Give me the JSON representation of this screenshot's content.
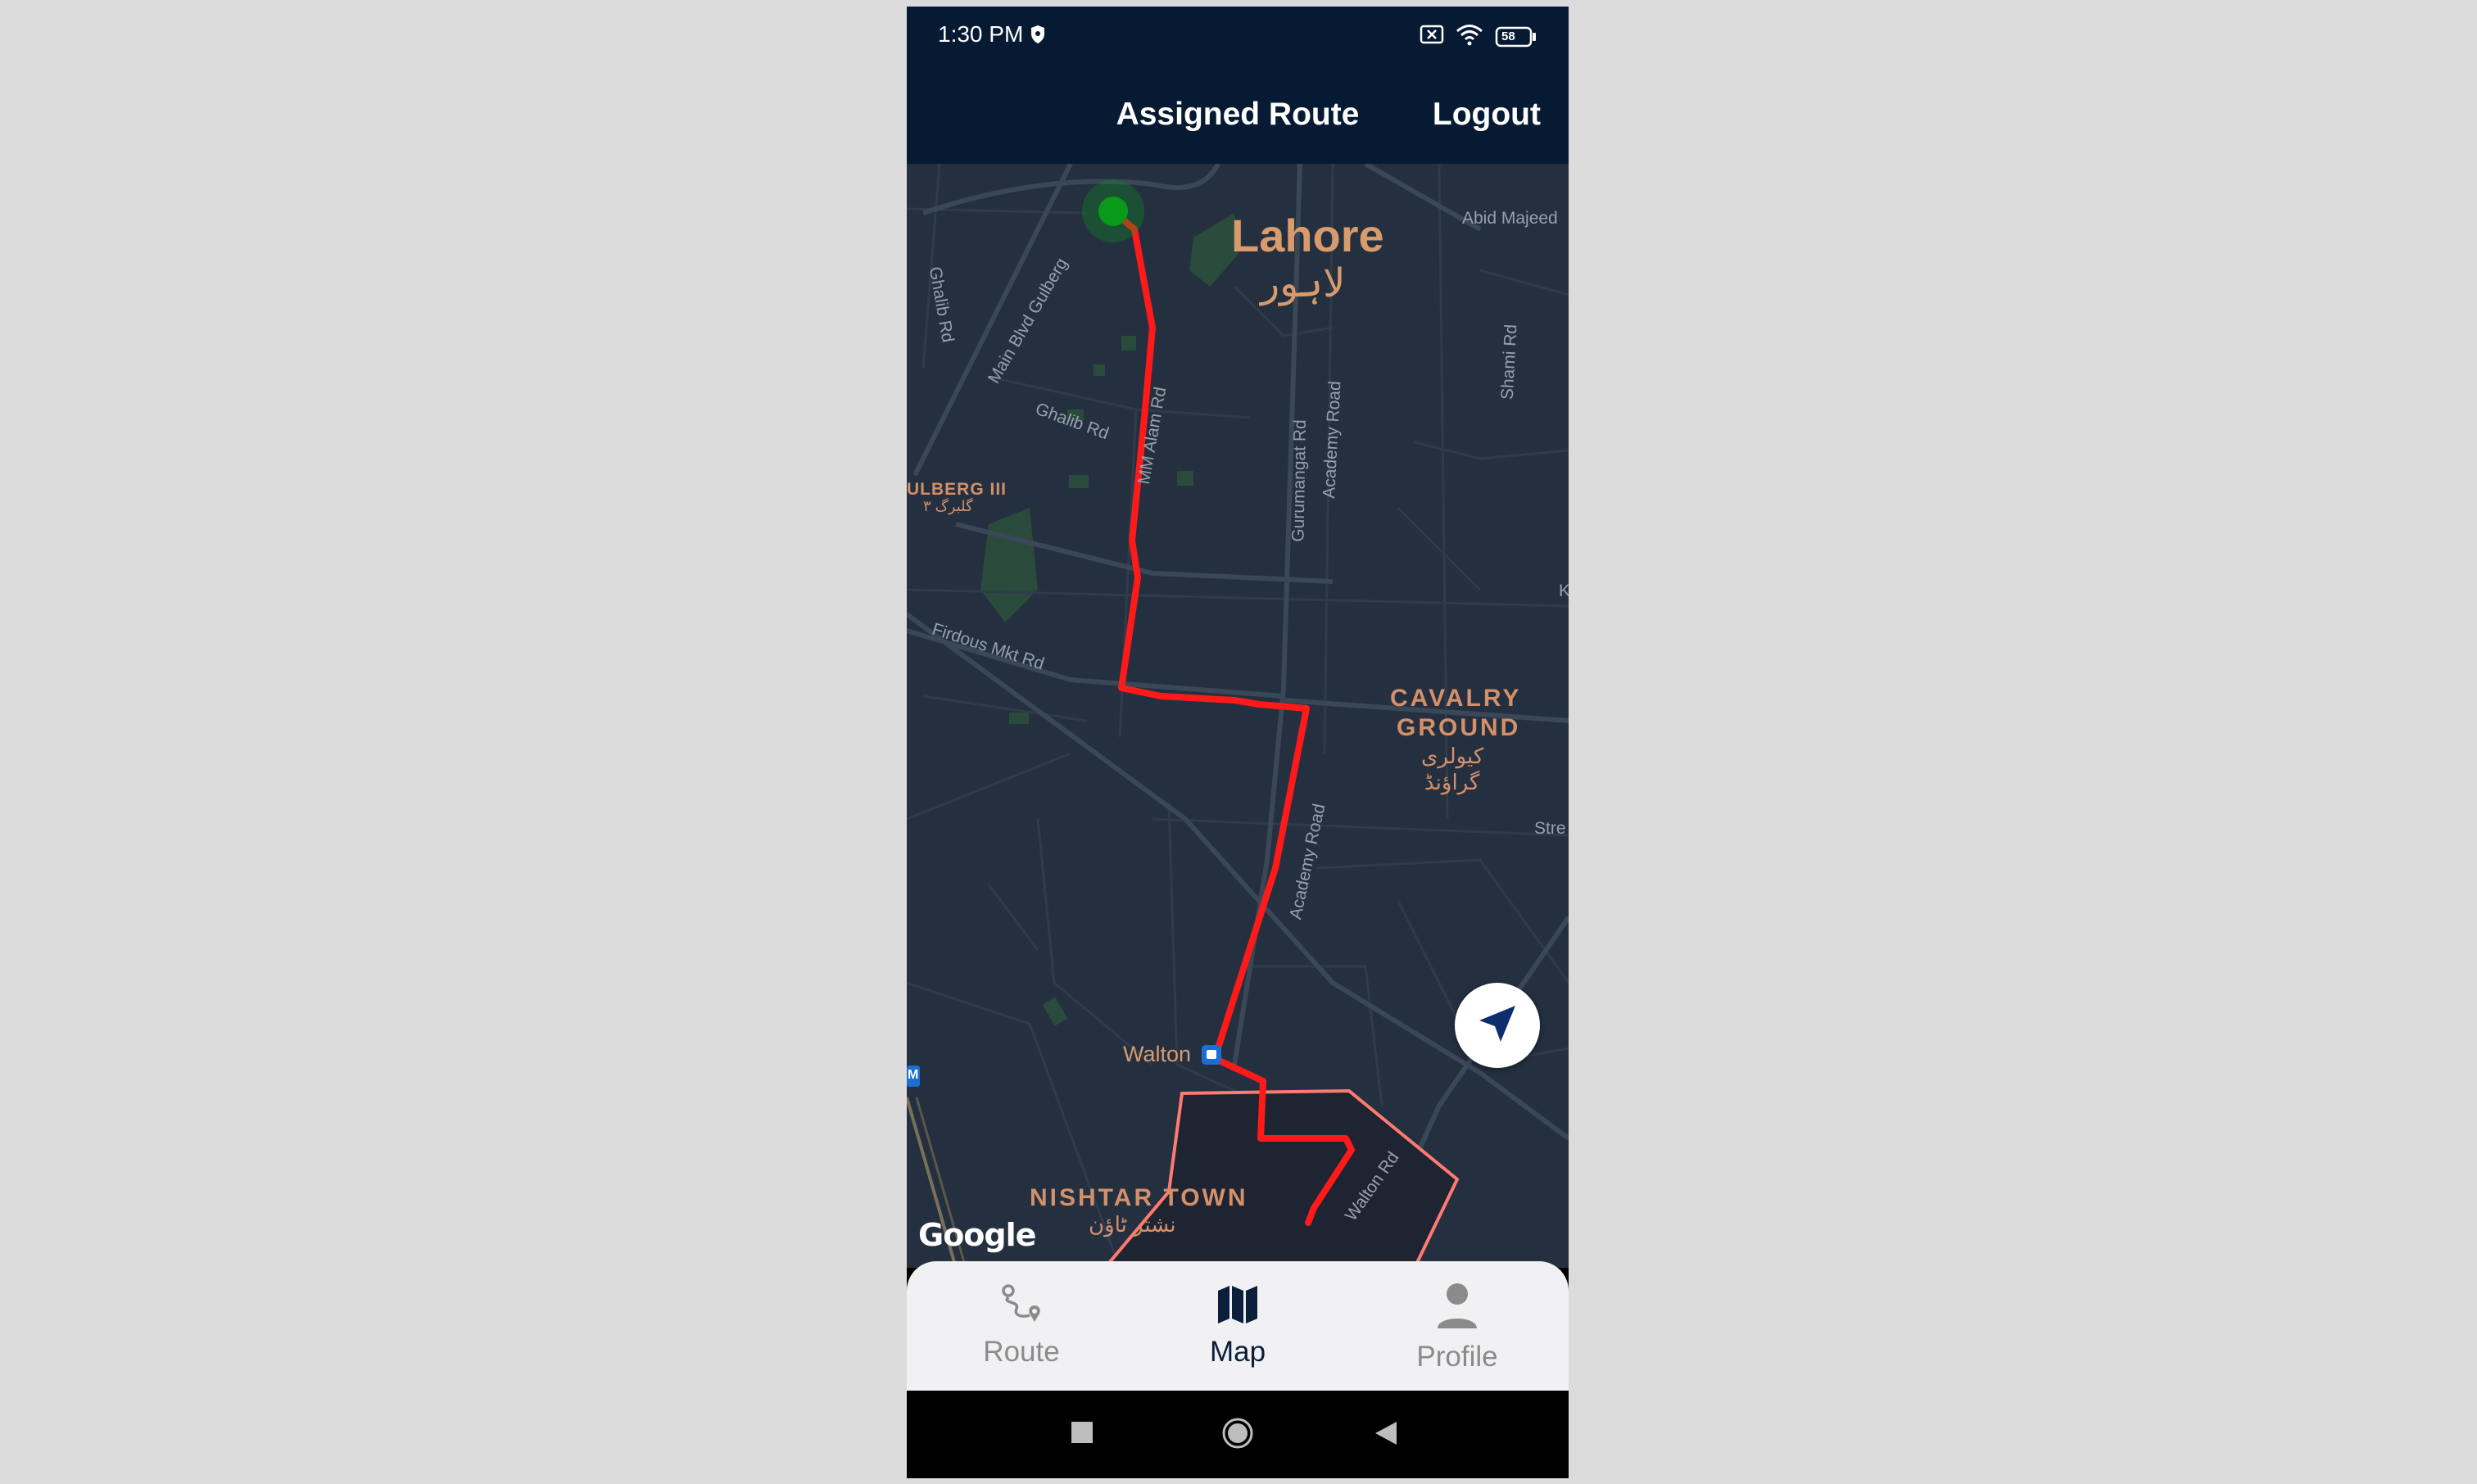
{
  "status_bar": {
    "time": "1:30 PM",
    "battery": "58",
    "icons": [
      "shield-icon",
      "data-off-icon",
      "wifi-icon",
      "battery-icon"
    ]
  },
  "header": {
    "title": "Assigned Route",
    "logout_label": "Logout"
  },
  "map": {
    "city_name": "Lahore",
    "city_name_urdu": "لاہور",
    "districts": {
      "gulberg": "ULBERG III",
      "gulberg_urdu": "گلبرگ ۳",
      "cavalry_line1": "CAVALRY",
      "cavalry_line2": "GROUND",
      "cavalry_urdu1": "کیولری",
      "cavalry_urdu2": "گراؤنڈ",
      "nishtar": "NISHTAR TOWN",
      "nishtar_urdu": "نشتر ٹاؤن"
    },
    "roads": {
      "abid_majeed": "Abid Majeed",
      "ghalib_rd_1": "Ghalib Rd",
      "main_blvd": "Main Blvd Gulberg",
      "ghalib_rd_2": "Ghalib Rd",
      "mm_alam": "MM Alam Rd",
      "gurumangat": "Gurumangat Rd",
      "academy_road_1": "Academy Road",
      "shami_rd": "Shami Rd",
      "firdous": "Firdous Mkt Rd",
      "academy_road_2": "Academy Road",
      "walton_rd": "Walton Rd",
      "stre": "Stre",
      "k": "K"
    },
    "station_name": "Walton",
    "metro_badge": "M",
    "attribution": "Google",
    "colors": {
      "route": "#ff1a1a",
      "start_marker": "#0a9a1a",
      "area_outline": "#ff7a70",
      "map_bg": "#243040"
    }
  },
  "locate_button_icon": "navigation-arrow-icon",
  "bottom_nav": {
    "items": [
      {
        "label": "Route",
        "icon": "route-icon",
        "active": false
      },
      {
        "label": "Map",
        "icon": "map-icon",
        "active": true
      },
      {
        "label": "Profile",
        "icon": "person-icon",
        "active": false
      }
    ]
  },
  "system_nav": [
    "recents-square-icon",
    "home-circle-icon",
    "back-triangle-icon"
  ]
}
